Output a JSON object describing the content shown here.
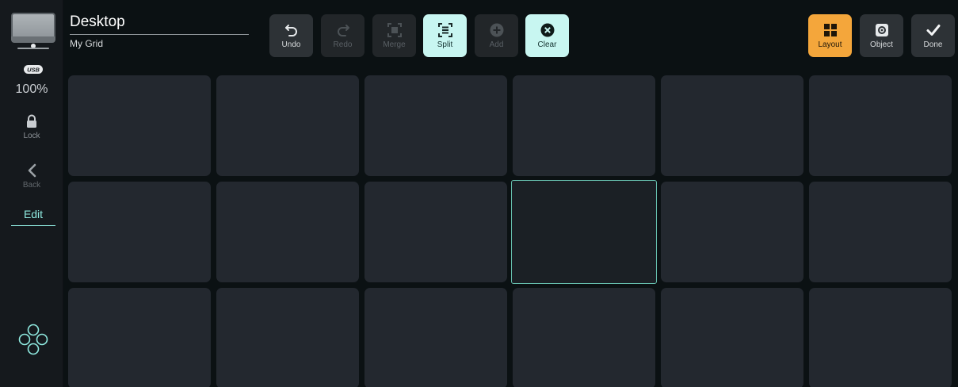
{
  "sidebar": {
    "usb_label": "USB",
    "zoom": "100%",
    "lock_label": "Lock",
    "back_label": "Back",
    "edit_label": "Edit"
  },
  "header": {
    "title": "Desktop",
    "subtitle": "My Grid"
  },
  "toolbar": {
    "undo": "Undo",
    "redo": "Redo",
    "merge": "Merge",
    "split": "Split",
    "add": "Add",
    "clear": "Clear",
    "layout": "Layout",
    "object": "Object",
    "done": "Done"
  },
  "colors": {
    "accent_teal": "#8feae0",
    "layout_orange": "#f4a63b",
    "cell_bg": "#23282f",
    "selection_border": "#66bfae"
  },
  "grid": {
    "rows": 3,
    "columns": 6,
    "selected_cell": {
      "row": 2,
      "column": 4
    }
  }
}
